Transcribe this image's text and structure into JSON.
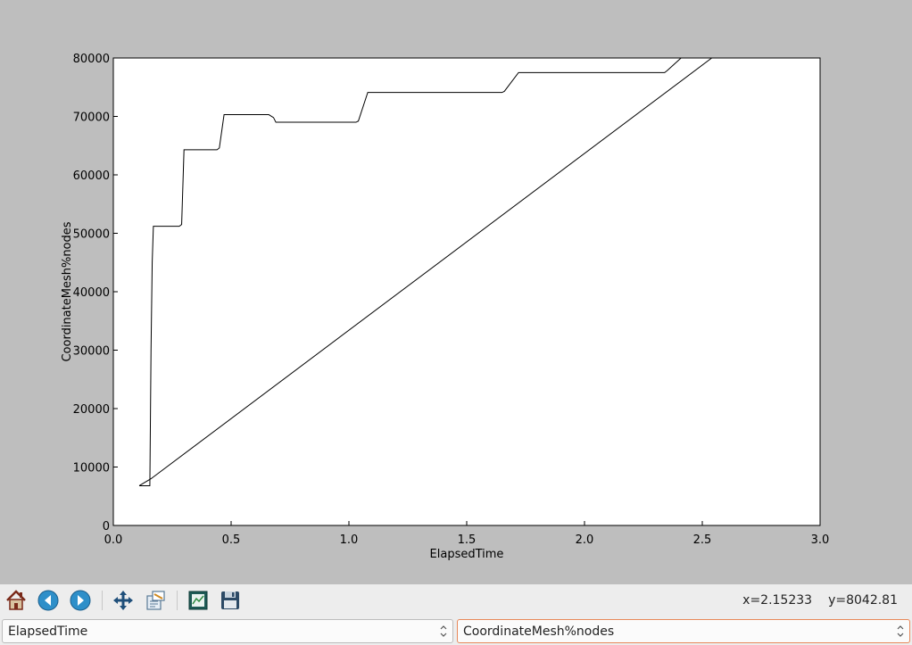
{
  "toolbar": {
    "buttons": [
      "home-icon",
      "back-arrow-icon",
      "forward-arrow-icon",
      "pan-icon",
      "zoom-icon",
      "subplots-icon",
      "save-icon"
    ],
    "coords": {
      "x": "x=2.15233",
      "y": "y=8042.81"
    }
  },
  "selectors": {
    "x_field": "ElapsedTime",
    "y_field": "CoordinateMesh%nodes"
  },
  "chart_data": {
    "type": "line",
    "title": "",
    "xlabel": "ElapsedTime",
    "ylabel": "CoordinateMesh%nodes",
    "xlim": [
      0,
      3
    ],
    "ylim": [
      0,
      80000
    ],
    "xticks": [
      0.0,
      0.5,
      1.0,
      1.5,
      2.0,
      2.5,
      3.0
    ],
    "xtick_labels": [
      "0.0",
      "0.5",
      "1.0",
      "1.5",
      "2.0",
      "2.5",
      "3.0"
    ],
    "yticks": [
      0,
      10000,
      20000,
      30000,
      40000,
      50000,
      60000,
      70000,
      80000
    ],
    "ytick_labels": [
      "0",
      "10000",
      "20000",
      "30000",
      "40000",
      "50000",
      "60000",
      "70000",
      "80000"
    ],
    "grid": false,
    "line_color": "#000000",
    "series": [
      {
        "x": [
          0.11,
          0.155,
          0.16,
          0.165,
          0.17,
          0.28,
          0.29,
          0.3,
          0.44,
          0.45,
          0.47,
          0.66,
          0.68,
          0.69,
          1.03,
          1.04,
          1.08,
          1.65,
          1.66,
          1.72,
          2.34,
          2.35,
          2.41,
          2.54,
          0.16,
          0.11
        ],
        "y": [
          6800,
          6800,
          30000,
          45000,
          51200,
          51200,
          51500,
          64300,
          64300,
          64600,
          70300,
          70300,
          69800,
          69000,
          69000,
          69200,
          74100,
          74100,
          74300,
          77500,
          77500,
          77800,
          80000,
          80000,
          8000,
          6800
        ]
      }
    ]
  }
}
